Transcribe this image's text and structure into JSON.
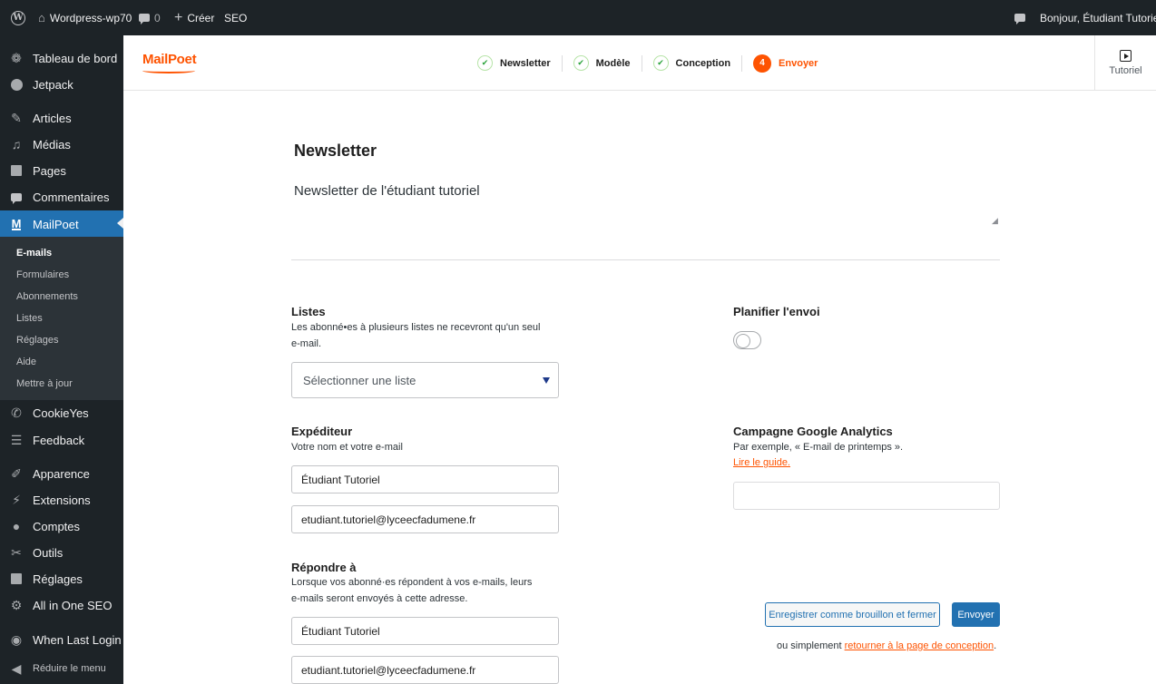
{
  "admin_bar": {
    "site_name": "Wordpress-wp70",
    "comments_count": "0",
    "new_label": "Créer",
    "seo_label": "SEO",
    "greeting": "Bonjour, Étudiant Tutoriel"
  },
  "sidebar": {
    "items": [
      {
        "label": "Tableau de bord",
        "icon": "dashboard-icon"
      },
      {
        "label": "Jetpack",
        "icon": "jetpack-icon"
      },
      {
        "label": "Articles",
        "icon": "pin-icon"
      },
      {
        "label": "Médias",
        "icon": "media-icon"
      },
      {
        "label": "Pages",
        "icon": "pages-icon"
      },
      {
        "label": "Commentaires",
        "icon": "comments-icon"
      },
      {
        "label": "MailPoet",
        "icon": "mailpoet-icon"
      },
      {
        "label": "CookieYes",
        "icon": "cookie-icon"
      },
      {
        "label": "Feedback",
        "icon": "feedback-icon"
      },
      {
        "label": "Apparence",
        "icon": "brush-icon"
      },
      {
        "label": "Extensions",
        "icon": "plugin-icon"
      },
      {
        "label": "Comptes",
        "icon": "users-icon"
      },
      {
        "label": "Outils",
        "icon": "wrench-icon"
      },
      {
        "label": "Réglages",
        "icon": "settings-icon"
      },
      {
        "label": "All in One SEO",
        "icon": "aioseo-icon"
      },
      {
        "label": "When Last Login",
        "icon": "eye-icon"
      },
      {
        "label": "Réduire le menu",
        "icon": "collapse-icon"
      }
    ],
    "submenu": [
      "E-mails",
      "Formulaires",
      "Abonnements",
      "Listes",
      "Réglages",
      "Aide",
      "Mettre à jour"
    ]
  },
  "header": {
    "logo": "MailPoet",
    "steps": [
      {
        "label": "Newsletter",
        "state": "done"
      },
      {
        "label": "Modèle",
        "state": "done"
      },
      {
        "label": "Conception",
        "state": "done"
      },
      {
        "label": "Envoyer",
        "state": "active",
        "number": "4"
      }
    ],
    "tutorial_label": "Tutoriel"
  },
  "form": {
    "section_title": "Newsletter",
    "subject_value": "Newsletter de l'étudiant tutoriel",
    "lists": {
      "title": "Listes",
      "help_line1": "Les abonné•es à plusieurs listes ne recevront qu'un seul",
      "help_line2": "e-mail.",
      "select_placeholder": "Sélectionner une liste"
    },
    "sender": {
      "title": "Expéditeur",
      "help": "Votre nom et votre e-mail",
      "name_value": "Étudiant Tutoriel",
      "email_value": "etudiant.tutoriel@lyceecfadumene.fr"
    },
    "reply_to": {
      "title": "Répondre à",
      "help_line1": "Lorsque vos abonné·es répondent à vos e-mails, leurs",
      "help_line2": "e-mails seront envoyés à cette adresse.",
      "name_value": "Étudiant Tutoriel",
      "email_value": "etudiant.tutoriel@lyceecfadumene.fr"
    },
    "schedule": {
      "title": "Planifier l'envoi",
      "enabled": false
    },
    "ga": {
      "title": "Campagne Google Analytics",
      "help": "Par exemple, « E-mail de printemps ».",
      "guide_link": "Lire le guide.",
      "value": ""
    },
    "actions": {
      "draft_label": "Enregistrer comme brouillon et fermer",
      "send_label": "Envoyer",
      "or_text": "ou simplement ",
      "back_link": "retourner à la page de conception",
      "end_punct": "."
    }
  }
}
